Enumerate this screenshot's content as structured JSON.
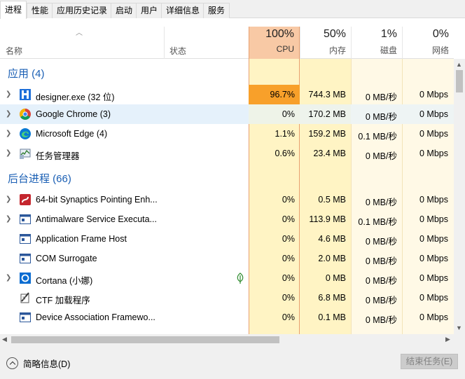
{
  "tabs": [
    "进程",
    "性能",
    "应用历史记录",
    "启动",
    "用户",
    "详细信息",
    "服务"
  ],
  "headers": {
    "name": "名称",
    "status": "状态",
    "cpu": {
      "pct": "100%",
      "label": "CPU"
    },
    "memory": {
      "pct": "50%",
      "label": "内存"
    },
    "disk": {
      "pct": "1%",
      "label": "磁盘"
    },
    "network": {
      "pct": "0%",
      "label": "网络"
    }
  },
  "groups": {
    "apps": "应用 (4)",
    "background": "后台进程 (66)"
  },
  "apps": [
    {
      "name": "designer.exe (32 位)",
      "cpu": "96.7%",
      "mem": "744.3 MB",
      "disk": "0 MB/秒",
      "net": "0 Mbps",
      "icon": "designer-icon"
    },
    {
      "name": "Google Chrome (3)",
      "cpu": "0%",
      "mem": "170.2 MB",
      "disk": "0 MB/秒",
      "net": "0 Mbps",
      "icon": "chrome-icon"
    },
    {
      "name": "Microsoft Edge (4)",
      "cpu": "1.1%",
      "mem": "159.2 MB",
      "disk": "0.1 MB/秒",
      "net": "0 Mbps",
      "icon": "edge-icon"
    },
    {
      "name": "任务管理器",
      "cpu": "0.6%",
      "mem": "23.4 MB",
      "disk": "0 MB/秒",
      "net": "0 Mbps",
      "icon": "task-manager-icon"
    }
  ],
  "background": [
    {
      "name": "64-bit Synaptics Pointing Enh...",
      "cpu": "0%",
      "mem": "0.5 MB",
      "disk": "0 MB/秒",
      "net": "0 Mbps",
      "icon": "synaptics-icon"
    },
    {
      "name": "Antimalware Service Executa...",
      "cpu": "0%",
      "mem": "113.9 MB",
      "disk": "0.1 MB/秒",
      "net": "0 Mbps",
      "icon": "app-window-icon"
    },
    {
      "name": "Application Frame Host",
      "cpu": "0%",
      "mem": "4.6 MB",
      "disk": "0 MB/秒",
      "net": "0 Mbps",
      "icon": "app-window-icon"
    },
    {
      "name": "COM Surrogate",
      "cpu": "0%",
      "mem": "2.0 MB",
      "disk": "0 MB/秒",
      "net": "0 Mbps",
      "icon": "app-window-icon"
    },
    {
      "name": "Cortana (小娜)",
      "cpu": "0%",
      "mem": "0 MB",
      "disk": "0 MB/秒",
      "net": "0 Mbps",
      "icon": "cortana-icon"
    },
    {
      "name": "CTF 加载程序",
      "cpu": "0%",
      "mem": "6.8 MB",
      "disk": "0 MB/秒",
      "net": "0 Mbps",
      "icon": "ctf-loader-icon"
    },
    {
      "name": "Device Association Framewo...",
      "cpu": "0%",
      "mem": "0.1 MB",
      "disk": "0 MB/秒",
      "net": "0 Mbps",
      "icon": "app-window-icon"
    }
  ],
  "footer": {
    "fewer_details": "简略信息(D)",
    "end_task": "结束任务(E)"
  },
  "colors": {
    "cpu_high": "#f8a02a",
    "cpu_header": "#f8c9a5",
    "cell_light": "#fff4c4",
    "cell_pale": "#fff9e6",
    "selected_row": "#e5f1fb",
    "group_text": "#1a5fb4"
  }
}
